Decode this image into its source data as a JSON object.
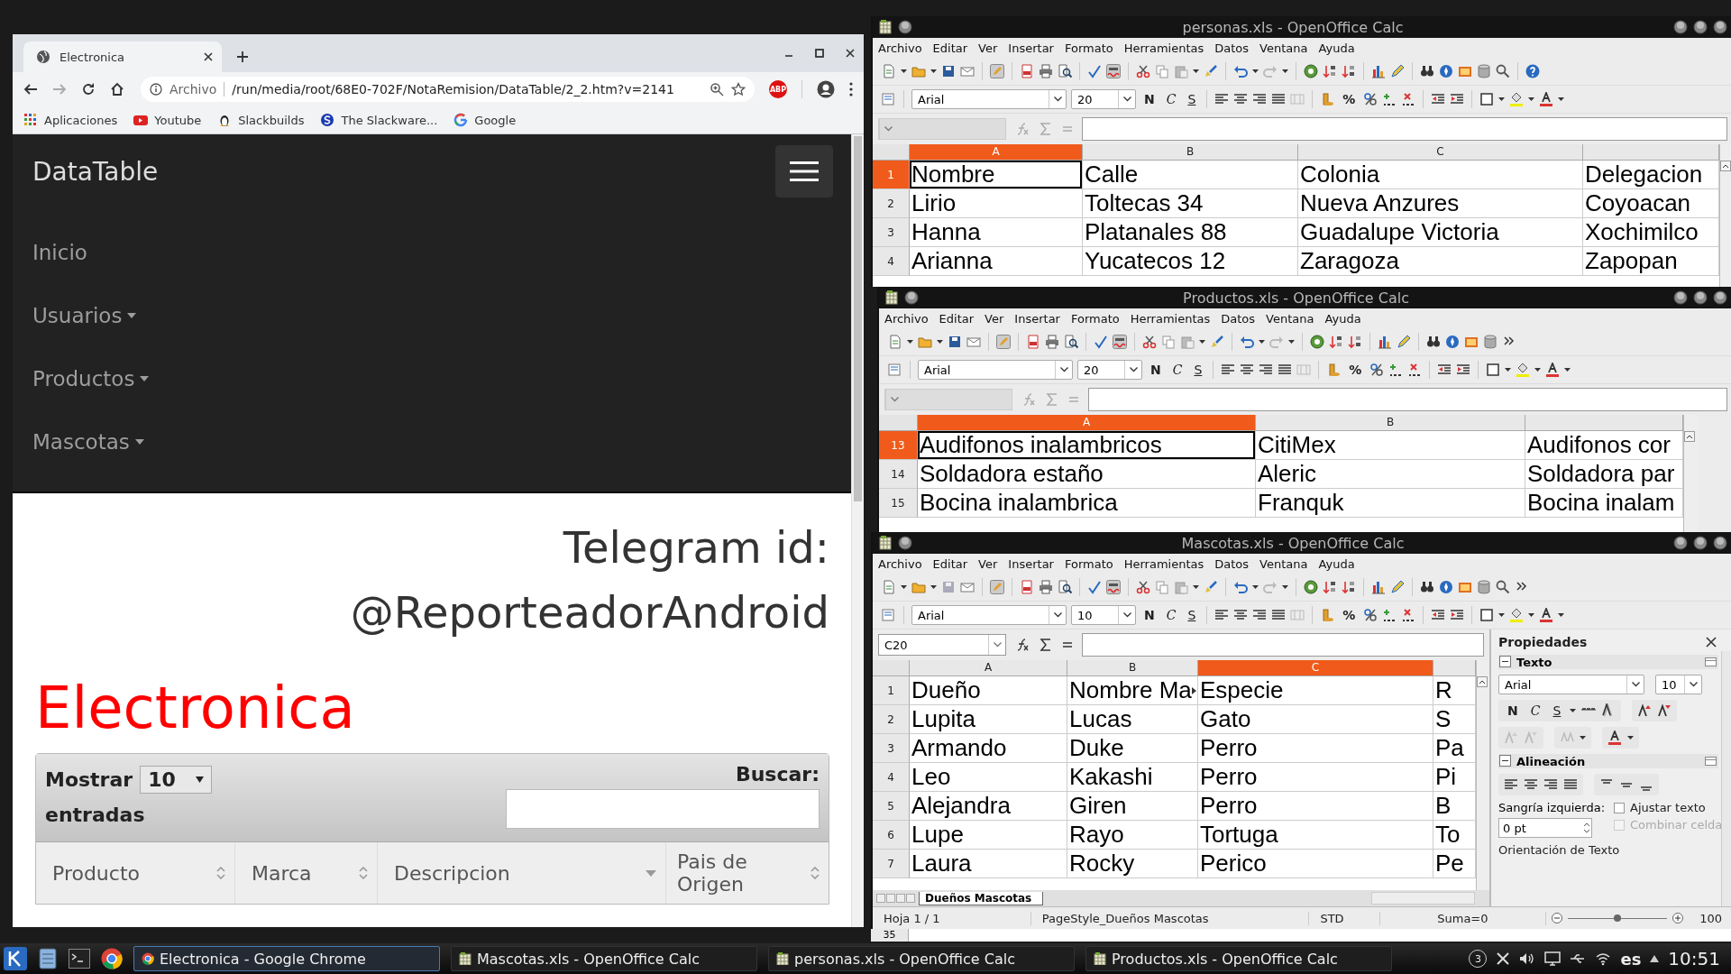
{
  "browser": {
    "tab": {
      "title": "Electronica",
      "selected": true
    },
    "address_bar": {
      "scheme": "Archivo",
      "url": "/run/media/root/68E0-702F/NotaRemision/DataTable/2_2.htm?v=2141"
    },
    "extension_badge": "ABP",
    "bookmarks": [
      {
        "label": "Aplicaciones",
        "kind": "apps"
      },
      {
        "label": "Youtube",
        "kind": "video"
      },
      {
        "label": "Slackbuilds",
        "kind": "penguin"
      },
      {
        "label": "The Slackware...",
        "kind": "circle"
      },
      {
        "label": "Google",
        "kind": "ring"
      }
    ],
    "navbar": {
      "brand": "DataTable",
      "items": [
        {
          "label": "Inicio",
          "dropdown": false
        },
        {
          "label": "Usuarios",
          "dropdown": true
        },
        {
          "label": "Productos",
          "dropdown": true
        },
        {
          "label": "Mascotas",
          "dropdown": true
        }
      ]
    },
    "page": {
      "contact_lines": [
        "Telegram id:",
        "@ReporteadorAndroid"
      ],
      "heading": "Electronica",
      "table": {
        "length_label": "Mostrar",
        "length_value": "10",
        "length_suffix": "entradas",
        "search_label": "Buscar:",
        "columns": [
          {
            "label": "Producto",
            "sorted": false
          },
          {
            "label": "Marca",
            "sorted": false
          },
          {
            "label": "Descripcion",
            "sorted": true
          },
          {
            "label": "Pais de Origen",
            "sorted": false
          }
        ]
      }
    }
  },
  "calc_windows": [
    {
      "title": "personas.xls - OpenOffice Calc",
      "menu": [
        "Archivo",
        "Editar",
        "Ver",
        "Insertar",
        "Formato",
        "Herramientas",
        "Datos",
        "Ventana",
        "Ayuda"
      ],
      "font": "Arial",
      "font_size": "20",
      "format_buttons": [
        "N",
        "C",
        "S"
      ],
      "percent": "%",
      "columns": [
        {
          "label": "A",
          "selected": true
        },
        {
          "label": "B",
          "selected": false
        },
        {
          "label": "C",
          "selected": false
        },
        {
          "selected": false
        }
      ],
      "rows": [
        {
          "number": "1",
          "selected": true,
          "cells": [
            {
              "text": "Nombre",
              "active": true
            },
            "Calle",
            "Colonia",
            "Delegacion"
          ]
        },
        {
          "number": "2",
          "selected": false,
          "cells": [
            "Lirio",
            "Toltecas 34",
            "Nueva Anzures",
            "Coyoacan"
          ]
        },
        {
          "number": "3",
          "selected": false,
          "cells": [
            "Hanna",
            "Platanales 88",
            "Guadalupe Victoria",
            "Xochimilco"
          ]
        },
        {
          "number": "4",
          "selected": false,
          "cells": [
            "Arianna",
            "Yucatecos 12",
            "Zaragoza",
            "Zapopan"
          ]
        }
      ]
    },
    {
      "title": "Productos.xls - OpenOffice Calc",
      "menu": [
        "Archivo",
        "Editar",
        "Ver",
        "Insertar",
        "Formato",
        "Herramientas",
        "Datos",
        "Ventana",
        "Ayuda"
      ],
      "font": "Arial",
      "font_size": "20",
      "format_buttons": [
        "N",
        "C",
        "S"
      ],
      "percent": "%",
      "columns": [
        {
          "label": "A",
          "selected": true
        },
        {
          "label": "B",
          "selected": false
        },
        {
          "selected": false
        }
      ],
      "rows": [
        {
          "number": "13",
          "selected": true,
          "cells": [
            {
              "text": "Audifonos inalambricos",
              "active": true
            },
            "CitiMex",
            "Audifonos cor"
          ]
        },
        {
          "number": "14",
          "selected": false,
          "cells": [
            "Soldadora estaño",
            "Aleric",
            "Soldadora par"
          ]
        },
        {
          "number": "15",
          "selected": false,
          "cells": [
            "Bocina inalambrica",
            "Franquk",
            "Bocina inalam"
          ]
        }
      ]
    },
    {
      "title": "Mascotas.xls - OpenOffice Calc",
      "menu": [
        "Archivo",
        "Editar",
        "Ver",
        "Insertar",
        "Formato",
        "Herramientas",
        "Datos",
        "Ventana",
        "Ayuda"
      ],
      "font": "Arial",
      "font_size": "10",
      "format_buttons": [
        "N",
        "C",
        "S"
      ],
      "percent": "%",
      "name_box": "C20",
      "columns": [
        {
          "label": "A",
          "selected": false
        },
        {
          "label": "B",
          "selected": false
        },
        {
          "label": "C",
          "selected": true
        },
        {
          "selected": false
        }
      ],
      "rows": [
        {
          "number": "1",
          "selected": false,
          "cells": [
            "Dueño",
            {
              "text": "Nombre Ma",
              "overflow": true
            },
            "Especie",
            "R"
          ]
        },
        {
          "number": "2",
          "selected": false,
          "cells": [
            "Lupita",
            "Lucas",
            "Gato",
            "S"
          ]
        },
        {
          "number": "3",
          "selected": false,
          "cells": [
            "Armando",
            "Duke",
            "Perro",
            "Pa"
          ]
        },
        {
          "number": "4",
          "selected": false,
          "cells": [
            "Leo",
            "Kakashi",
            "Perro",
            "Pi"
          ]
        },
        {
          "number": "5",
          "selected": false,
          "cells": [
            "Alejandra",
            "Giren",
            "Perro",
            "B"
          ]
        },
        {
          "number": "6",
          "selected": false,
          "cells": [
            "Lupe",
            "Rayo",
            "Tortuga",
            "To"
          ]
        },
        {
          "number": "7",
          "selected": false,
          "cells": [
            "Laura",
            "Rocky",
            "Perico",
            "Pe"
          ]
        }
      ],
      "sheet_tabs": [
        {
          "label": "Dueños Mascotas",
          "selected": true
        }
      ],
      "status_bar": [
        "Hoja 1 / 1",
        "PageStyle_Dueños Mascotas",
        "STD",
        "Suma=0",
        "100"
      ],
      "zoom_slider": {
        "level": 0.5
      },
      "properties": {
        "title": "Propiedades",
        "text_section": "Texto",
        "font": "Arial",
        "font_size": "10",
        "buttons": [
          "N",
          "C",
          "S"
        ],
        "align_section": "Alineación",
        "indent_label": "Sangría izquierda:",
        "indent_value": "0 pt",
        "options": [
          {
            "label": "Ajustar texto",
            "checked": false,
            "disabled": false
          },
          {
            "label": "Combinar celda",
            "checked": false,
            "disabled": true
          }
        ],
        "footer": "Orientación de Texto"
      }
    }
  ],
  "background_row_number": "35",
  "taskbar": {
    "items": [
      {
        "label": "Electronica - Google Chrome",
        "selected": true,
        "kind": "browser"
      },
      {
        "label": "Mascotas.xls - OpenOffice Calc",
        "selected": false,
        "kind": "sheet"
      },
      {
        "label": "personas.xls - OpenOffice Calc",
        "selected": false,
        "kind": "sheet"
      },
      {
        "label": "Productos.xls - OpenOffice Calc",
        "selected": false,
        "kind": "sheet"
      }
    ],
    "tray_badge": "3",
    "keyboard_layout": "es",
    "clock": "10:51"
  }
}
